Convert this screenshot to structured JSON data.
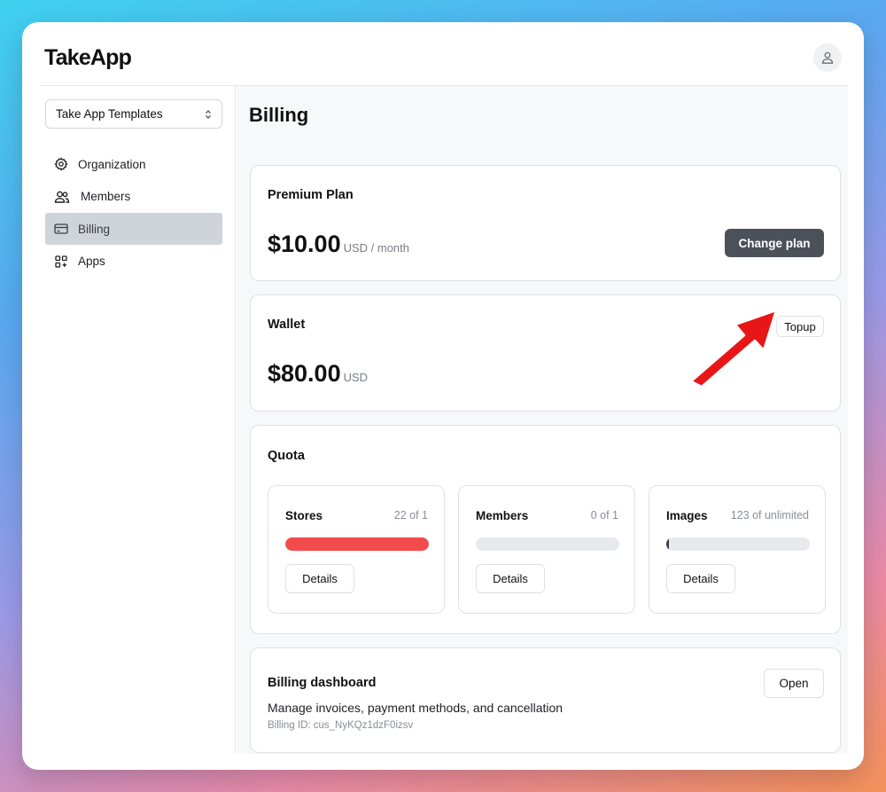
{
  "app": {
    "logo": "TakeApp"
  },
  "sidebar": {
    "org_select": "Take App Templates",
    "items": [
      {
        "label": "Organization",
        "icon": "gear-icon"
      },
      {
        "label": "Members",
        "icon": "users-icon"
      },
      {
        "label": "Billing",
        "icon": "credit-card-icon",
        "active": true
      },
      {
        "label": "Apps",
        "icon": "apps-icon"
      }
    ]
  },
  "main": {
    "title": "Billing",
    "plan": {
      "title": "Premium Plan",
      "amount": "$10.00",
      "unit": "USD / month",
      "button": "Change plan"
    },
    "wallet": {
      "title": "Wallet",
      "amount": "$80.00",
      "unit": "USD",
      "button": "Topup"
    },
    "quota": {
      "title": "Quota",
      "items": [
        {
          "label": "Stores",
          "count": "22 of 1",
          "progress": 1.0,
          "color": "#f24b4b",
          "button": "Details"
        },
        {
          "label": "Members",
          "count": "0 of 1",
          "progress": 0.0,
          "color": "#e7e9ec",
          "button": "Details"
        },
        {
          "label": "Images",
          "count": "123 of unlimited",
          "progress": 0.01,
          "color": "#3a3d45",
          "button": "Details"
        }
      ]
    },
    "dashboard": {
      "title": "Billing dashboard",
      "description": "Manage invoices, payment methods, and cancellation",
      "billing_id": "Billing ID: cus_NyKQz1dzF0izsv",
      "button": "Open"
    }
  },
  "colors": {
    "accent_dark": "#4b5059",
    "active_nav": "#cfd3da",
    "danger": "#f24b4b",
    "annotation_arrow": "#e81919"
  }
}
